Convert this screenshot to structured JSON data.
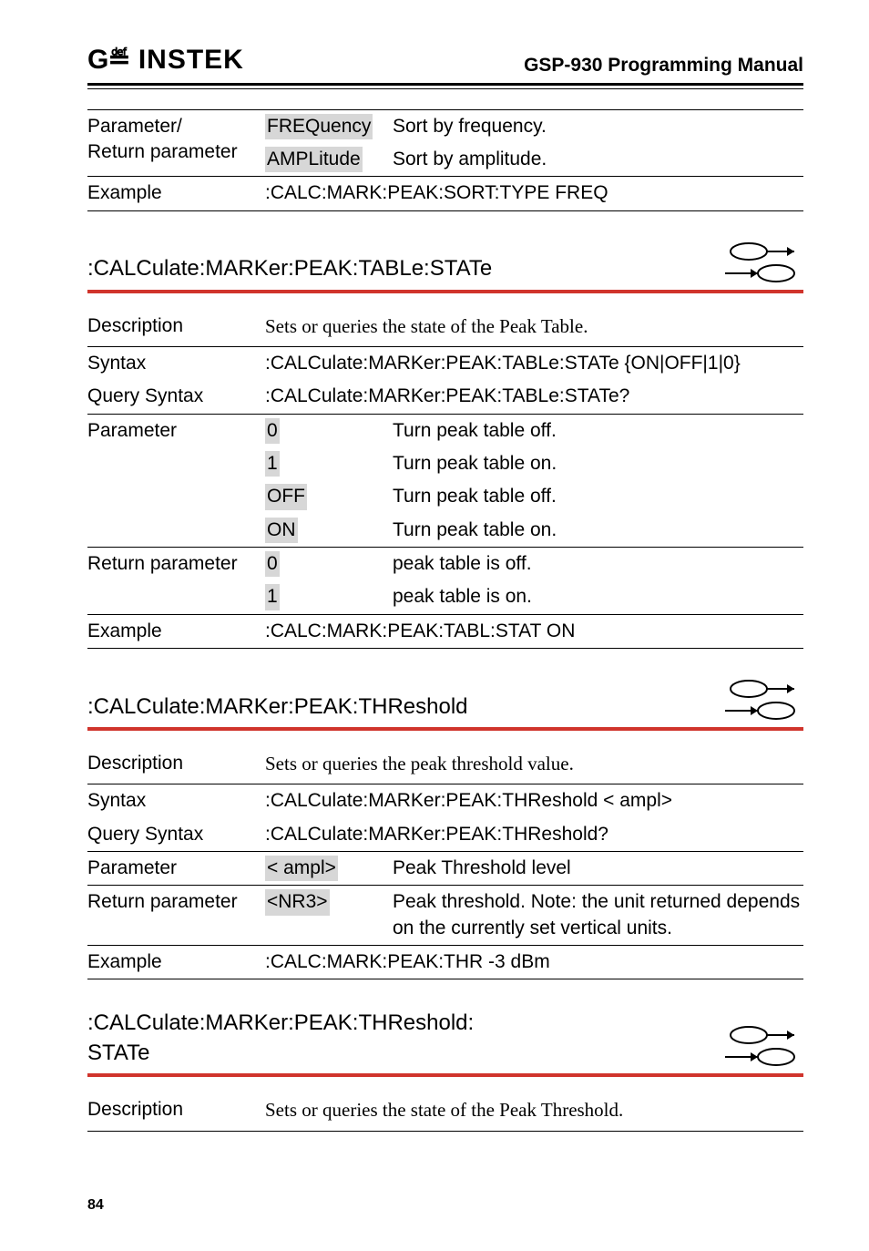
{
  "header": {
    "logo": "GWINSTEK",
    "doc_title": "GSP-930 Programming Manual"
  },
  "block1": {
    "label1": "Parameter/",
    "label2": "Return parameter",
    "p1": "FREQuency",
    "v1": "Sort by frequency.",
    "p2": "AMPLitude",
    "v2": "Sort by amplitude.",
    "example_label": "Example",
    "example_val": ":CALC:MARK:PEAK:SORT:TYPE FREQ"
  },
  "sec1": {
    "title": ":CALCulate:MARKer:PEAK:TABLe:STATe",
    "desc_label": "Description",
    "desc_val": "Sets or queries the state of the Peak Table.",
    "syntax_label": "Syntax",
    "syntax_val": ":CALCulate:MARKer:PEAK:TABLe:STATe {ON|OFF|1|0}",
    "qsyntax_label": "Query Syntax",
    "qsyntax_val": ":CALCulate:MARKer:PEAK:TABLe:STATe?",
    "param_label": "Parameter",
    "param": [
      {
        "p": "0",
        "v": "Turn peak table off."
      },
      {
        "p": "1",
        "v": "Turn peak table on."
      },
      {
        "p": "OFF",
        "v": "Turn peak table off."
      },
      {
        "p": "ON",
        "v": "Turn peak table on."
      }
    ],
    "ret_label": "Return parameter",
    "ret": [
      {
        "p": "0",
        "v": "peak table is off."
      },
      {
        "p": "1",
        "v": "peak table is on."
      }
    ],
    "example_label": "Example",
    "example_val": ":CALC:MARK:PEAK:TABL:STAT ON"
  },
  "sec2": {
    "title": ":CALCulate:MARKer:PEAK:THReshold",
    "desc_label": "Description",
    "desc_val": "Sets or queries the peak threshold value.",
    "syntax_label": "Syntax",
    "syntax_val": ":CALCulate:MARKer:PEAK:THReshold < ampl>",
    "qsyntax_label": "Query Syntax",
    "qsyntax_val": ":CALCulate:MARKer:PEAK:THReshold?",
    "param_label": "Parameter",
    "param_p": "< ampl>",
    "param_v": "Peak Threshold level",
    "ret_label": "Return parameter",
    "ret_p": "<NR3>",
    "ret_v": "Peak threshold. Note: the unit returned depends on the currently set vertical units.",
    "example_label": "Example",
    "example_val": ":CALC:MARK:PEAK:THR -3 dBm"
  },
  "sec3": {
    "title_l1": ":CALCulate:MARKer:PEAK:THReshold:",
    "title_l2": "STATe",
    "desc_label": "Description",
    "desc_val": "Sets or queries the state of the Peak Threshold."
  },
  "page": "84"
}
